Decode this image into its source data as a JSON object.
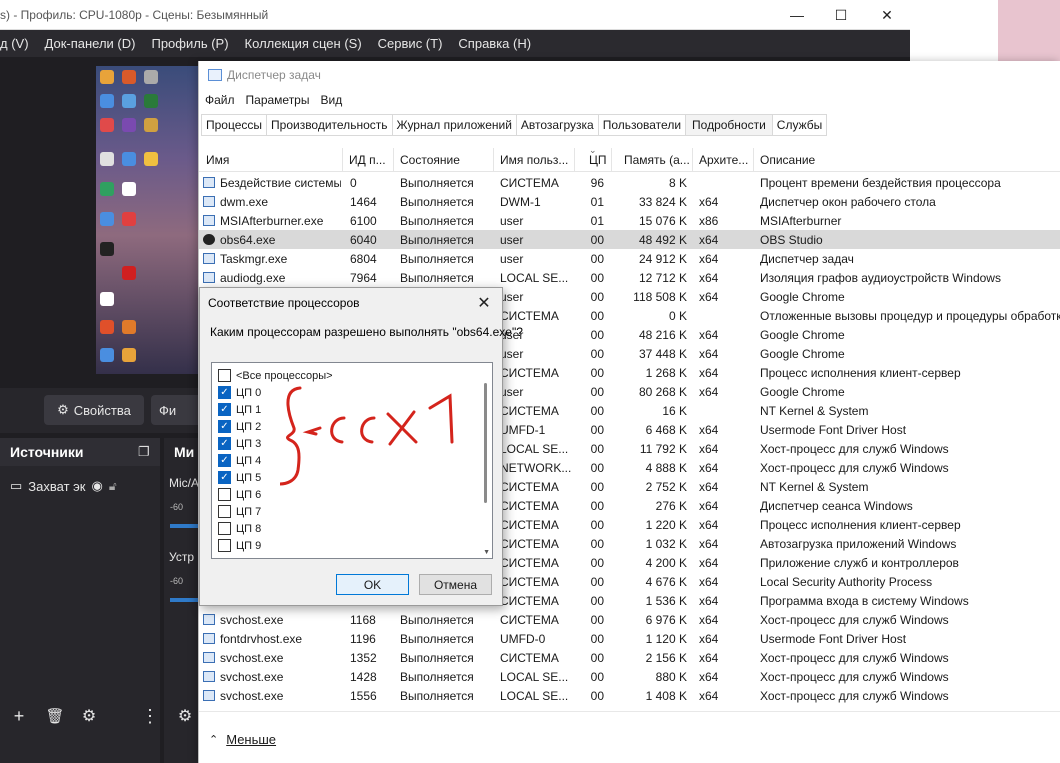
{
  "obs": {
    "title": "s) - Профиль: CPU-1080p - Сцены: Безымянный",
    "menu": [
      "д (V)",
      "Док-панели (D)",
      "Профиль (P)",
      "Коллекция сцен (S)",
      "Сервис (T)",
      "Справка (H)"
    ],
    "properties_button": "Свойства",
    "filters_button": "Фи",
    "sources_title": "Источники",
    "source_item": "Захват эк",
    "mixer_title": "Ми",
    "mixer_channels": [
      {
        "label": "Mic/A",
        "db": "-60"
      },
      {
        "label": "Устр",
        "db": "-60"
      }
    ],
    "icons": {
      "minimize": "minimize-icon",
      "maximize": "maximize-icon",
      "close": "close-icon",
      "gear": "gear-icon",
      "eye": "eye-icon",
      "lock": "lock-icon",
      "plus": "plus-icon",
      "trash": "trash-icon",
      "more": "more-icon"
    }
  },
  "task_manager": {
    "title": "Диспетчер задач",
    "menu": [
      "Файл",
      "Параметры",
      "Вид"
    ],
    "tabs": [
      "Процессы",
      "Производительность",
      "Журнал приложений",
      "Автозагрузка",
      "Пользователи",
      "Подробности",
      "Службы"
    ],
    "active_tab": "Подробности",
    "columns": [
      "Имя",
      "ИД п...",
      "Состояние",
      "Имя польз...",
      "ЦП",
      "Память (а...",
      "Архите...",
      "Описание"
    ],
    "rows": [
      {
        "name": "Бездействие системы",
        "pid": "0",
        "state": "Выполняется",
        "user": "СИСТЕМА",
        "cpu": "96",
        "mem": "8 K",
        "arch": "",
        "desc": "Процент времени бездействия процессора"
      },
      {
        "name": "dwm.exe",
        "pid": "1464",
        "state": "Выполняется",
        "user": "DWM-1",
        "cpu": "01",
        "mem": "33 824 K",
        "arch": "x64",
        "desc": "Диспетчер окон рабочего стола"
      },
      {
        "name": "MSIAfterburner.exe",
        "pid": "6100",
        "state": "Выполняется",
        "user": "user",
        "cpu": "01",
        "mem": "15 076 K",
        "arch": "x86",
        "desc": "MSIAfterburner"
      },
      {
        "name": "obs64.exe",
        "pid": "6040",
        "state": "Выполняется",
        "user": "user",
        "cpu": "00",
        "mem": "48 492 K",
        "arch": "x64",
        "desc": "OBS Studio"
      },
      {
        "name": "Taskmgr.exe",
        "pid": "6804",
        "state": "Выполняется",
        "user": "user",
        "cpu": "00",
        "mem": "24 912 K",
        "arch": "x64",
        "desc": "Диспетчер задач"
      },
      {
        "name": "audiodg.exe",
        "pid": "7964",
        "state": "Выполняется",
        "user": "LOCAL SE...",
        "cpu": "00",
        "mem": "12 712 K",
        "arch": "x64",
        "desc": "Изоляция графов аудиоустройств Windows"
      },
      {
        "name": "",
        "pid": "",
        "state": "",
        "user": "user",
        "cpu": "00",
        "mem": "118 508 K",
        "arch": "x64",
        "desc": "Google Chrome"
      },
      {
        "name": "",
        "pid": "",
        "state": "",
        "user": "СИСТЕМА",
        "cpu": "00",
        "mem": "0 K",
        "arch": "",
        "desc": "Отложенные вызовы процедур и процедуры обработки"
      },
      {
        "name": "",
        "pid": "",
        "state": "",
        "user": "user",
        "cpu": "00",
        "mem": "48 216 K",
        "arch": "x64",
        "desc": "Google Chrome"
      },
      {
        "name": "",
        "pid": "",
        "state": "",
        "user": "user",
        "cpu": "00",
        "mem": "37 448 K",
        "arch": "x64",
        "desc": "Google Chrome"
      },
      {
        "name": "",
        "pid": "",
        "state": "",
        "user": "СИСТЕМА",
        "cpu": "00",
        "mem": "1 268 K",
        "arch": "x64",
        "desc": "Процесс исполнения клиент-сервер"
      },
      {
        "name": "",
        "pid": "",
        "state": "",
        "user": "user",
        "cpu": "00",
        "mem": "80 268 K",
        "arch": "x64",
        "desc": "Google Chrome"
      },
      {
        "name": "",
        "pid": "",
        "state": "",
        "user": "СИСТЕМА",
        "cpu": "00",
        "mem": "16 K",
        "arch": "",
        "desc": "NT Kernel & System"
      },
      {
        "name": "",
        "pid": "",
        "state": "",
        "user": "UMFD-1",
        "cpu": "00",
        "mem": "6 468 K",
        "arch": "x64",
        "desc": "Usermode Font Driver Host"
      },
      {
        "name": "",
        "pid": "",
        "state": "",
        "user": "LOCAL SE...",
        "cpu": "00",
        "mem": "11 792 K",
        "arch": "x64",
        "desc": "Хост-процесс для служб Windows"
      },
      {
        "name": "",
        "pid": "",
        "state": "",
        "user": "NETWORK...",
        "cpu": "00",
        "mem": "4 888 K",
        "arch": "x64",
        "desc": "Хост-процесс для служб Windows"
      },
      {
        "name": "",
        "pid": "",
        "state": "",
        "user": "СИСТЕМА",
        "cpu": "00",
        "mem": "2 752 K",
        "arch": "x64",
        "desc": "NT Kernel & System"
      },
      {
        "name": "",
        "pid": "",
        "state": "",
        "user": "СИСТЕМА",
        "cpu": "00",
        "mem": "276 K",
        "arch": "x64",
        "desc": "Диспетчер сеанса  Windows"
      },
      {
        "name": "",
        "pid": "",
        "state": "",
        "user": "СИСТЕМА",
        "cpu": "00",
        "mem": "1 220 K",
        "arch": "x64",
        "desc": "Процесс исполнения клиент-сервер"
      },
      {
        "name": "",
        "pid": "",
        "state": "",
        "user": "СИСТЕМА",
        "cpu": "00",
        "mem": "1 032 K",
        "arch": "x64",
        "desc": "Автозагрузка приложений Windows"
      },
      {
        "name": "",
        "pid": "",
        "state": "",
        "user": "СИСТЕМА",
        "cpu": "00",
        "mem": "4 200 K",
        "arch": "x64",
        "desc": "Приложение служб и контроллеров"
      },
      {
        "name": "",
        "pid": "",
        "state": "",
        "user": "СИСТЕМА",
        "cpu": "00",
        "mem": "4 676 K",
        "arch": "x64",
        "desc": "Local Security Authority Process"
      },
      {
        "name": "",
        "pid": "",
        "state": "",
        "user": "СИСТЕМА",
        "cpu": "00",
        "mem": "1 536 K",
        "arch": "x64",
        "desc": "Программа входа в систему Windows"
      },
      {
        "name": "svchost.exe",
        "pid": "1168",
        "state": "Выполняется",
        "user": "СИСТЕМА",
        "cpu": "00",
        "mem": "6 976 K",
        "arch": "x64",
        "desc": "Хост-процесс для служб Windows"
      },
      {
        "name": "fontdrvhost.exe",
        "pid": "1196",
        "state": "Выполняется",
        "user": "UMFD-0",
        "cpu": "00",
        "mem": "1 120 K",
        "arch": "x64",
        "desc": "Usermode Font Driver Host"
      },
      {
        "name": "svchost.exe",
        "pid": "1352",
        "state": "Выполняется",
        "user": "СИСТЕМА",
        "cpu": "00",
        "mem": "2 156 K",
        "arch": "x64",
        "desc": "Хост-процесс для служб Windows"
      },
      {
        "name": "svchost.exe",
        "pid": "1428",
        "state": "Выполняется",
        "user": "LOCAL SE...",
        "cpu": "00",
        "mem": "880 K",
        "arch": "x64",
        "desc": "Хост-процесс для служб Windows"
      },
      {
        "name": "svchost.exe",
        "pid": "1556",
        "state": "Выполняется",
        "user": "LOCAL SE...",
        "cpu": "00",
        "mem": "1 408 K",
        "arch": "x64",
        "desc": "Хост-процесс для служб Windows"
      }
    ],
    "selected_row": 3,
    "less_button": "Меньше"
  },
  "affinity_dialog": {
    "title": "Соответствие процессоров",
    "prompt": "Каким процессорам разрешено выполнять \"obs64.exe\"?",
    "items": [
      {
        "label": "<Все процессоры>",
        "checked": false
      },
      {
        "label": "ЦП 0",
        "checked": true
      },
      {
        "label": "ЦП 1",
        "checked": true
      },
      {
        "label": "ЦП 2",
        "checked": true
      },
      {
        "label": "ЦП 3",
        "checked": true
      },
      {
        "label": "ЦП 4",
        "checked": true
      },
      {
        "label": "ЦП 5",
        "checked": true
      },
      {
        "label": "ЦП 6",
        "checked": false
      },
      {
        "label": "ЦП 7",
        "checked": false
      },
      {
        "label": "ЦП 8",
        "checked": false
      },
      {
        "label": "ЦП 9",
        "checked": false
      }
    ],
    "ok_label": "OK",
    "cancel_label": "Отмена"
  },
  "annotation": {
    "text": "ccx1",
    "color": "#d4241c"
  }
}
